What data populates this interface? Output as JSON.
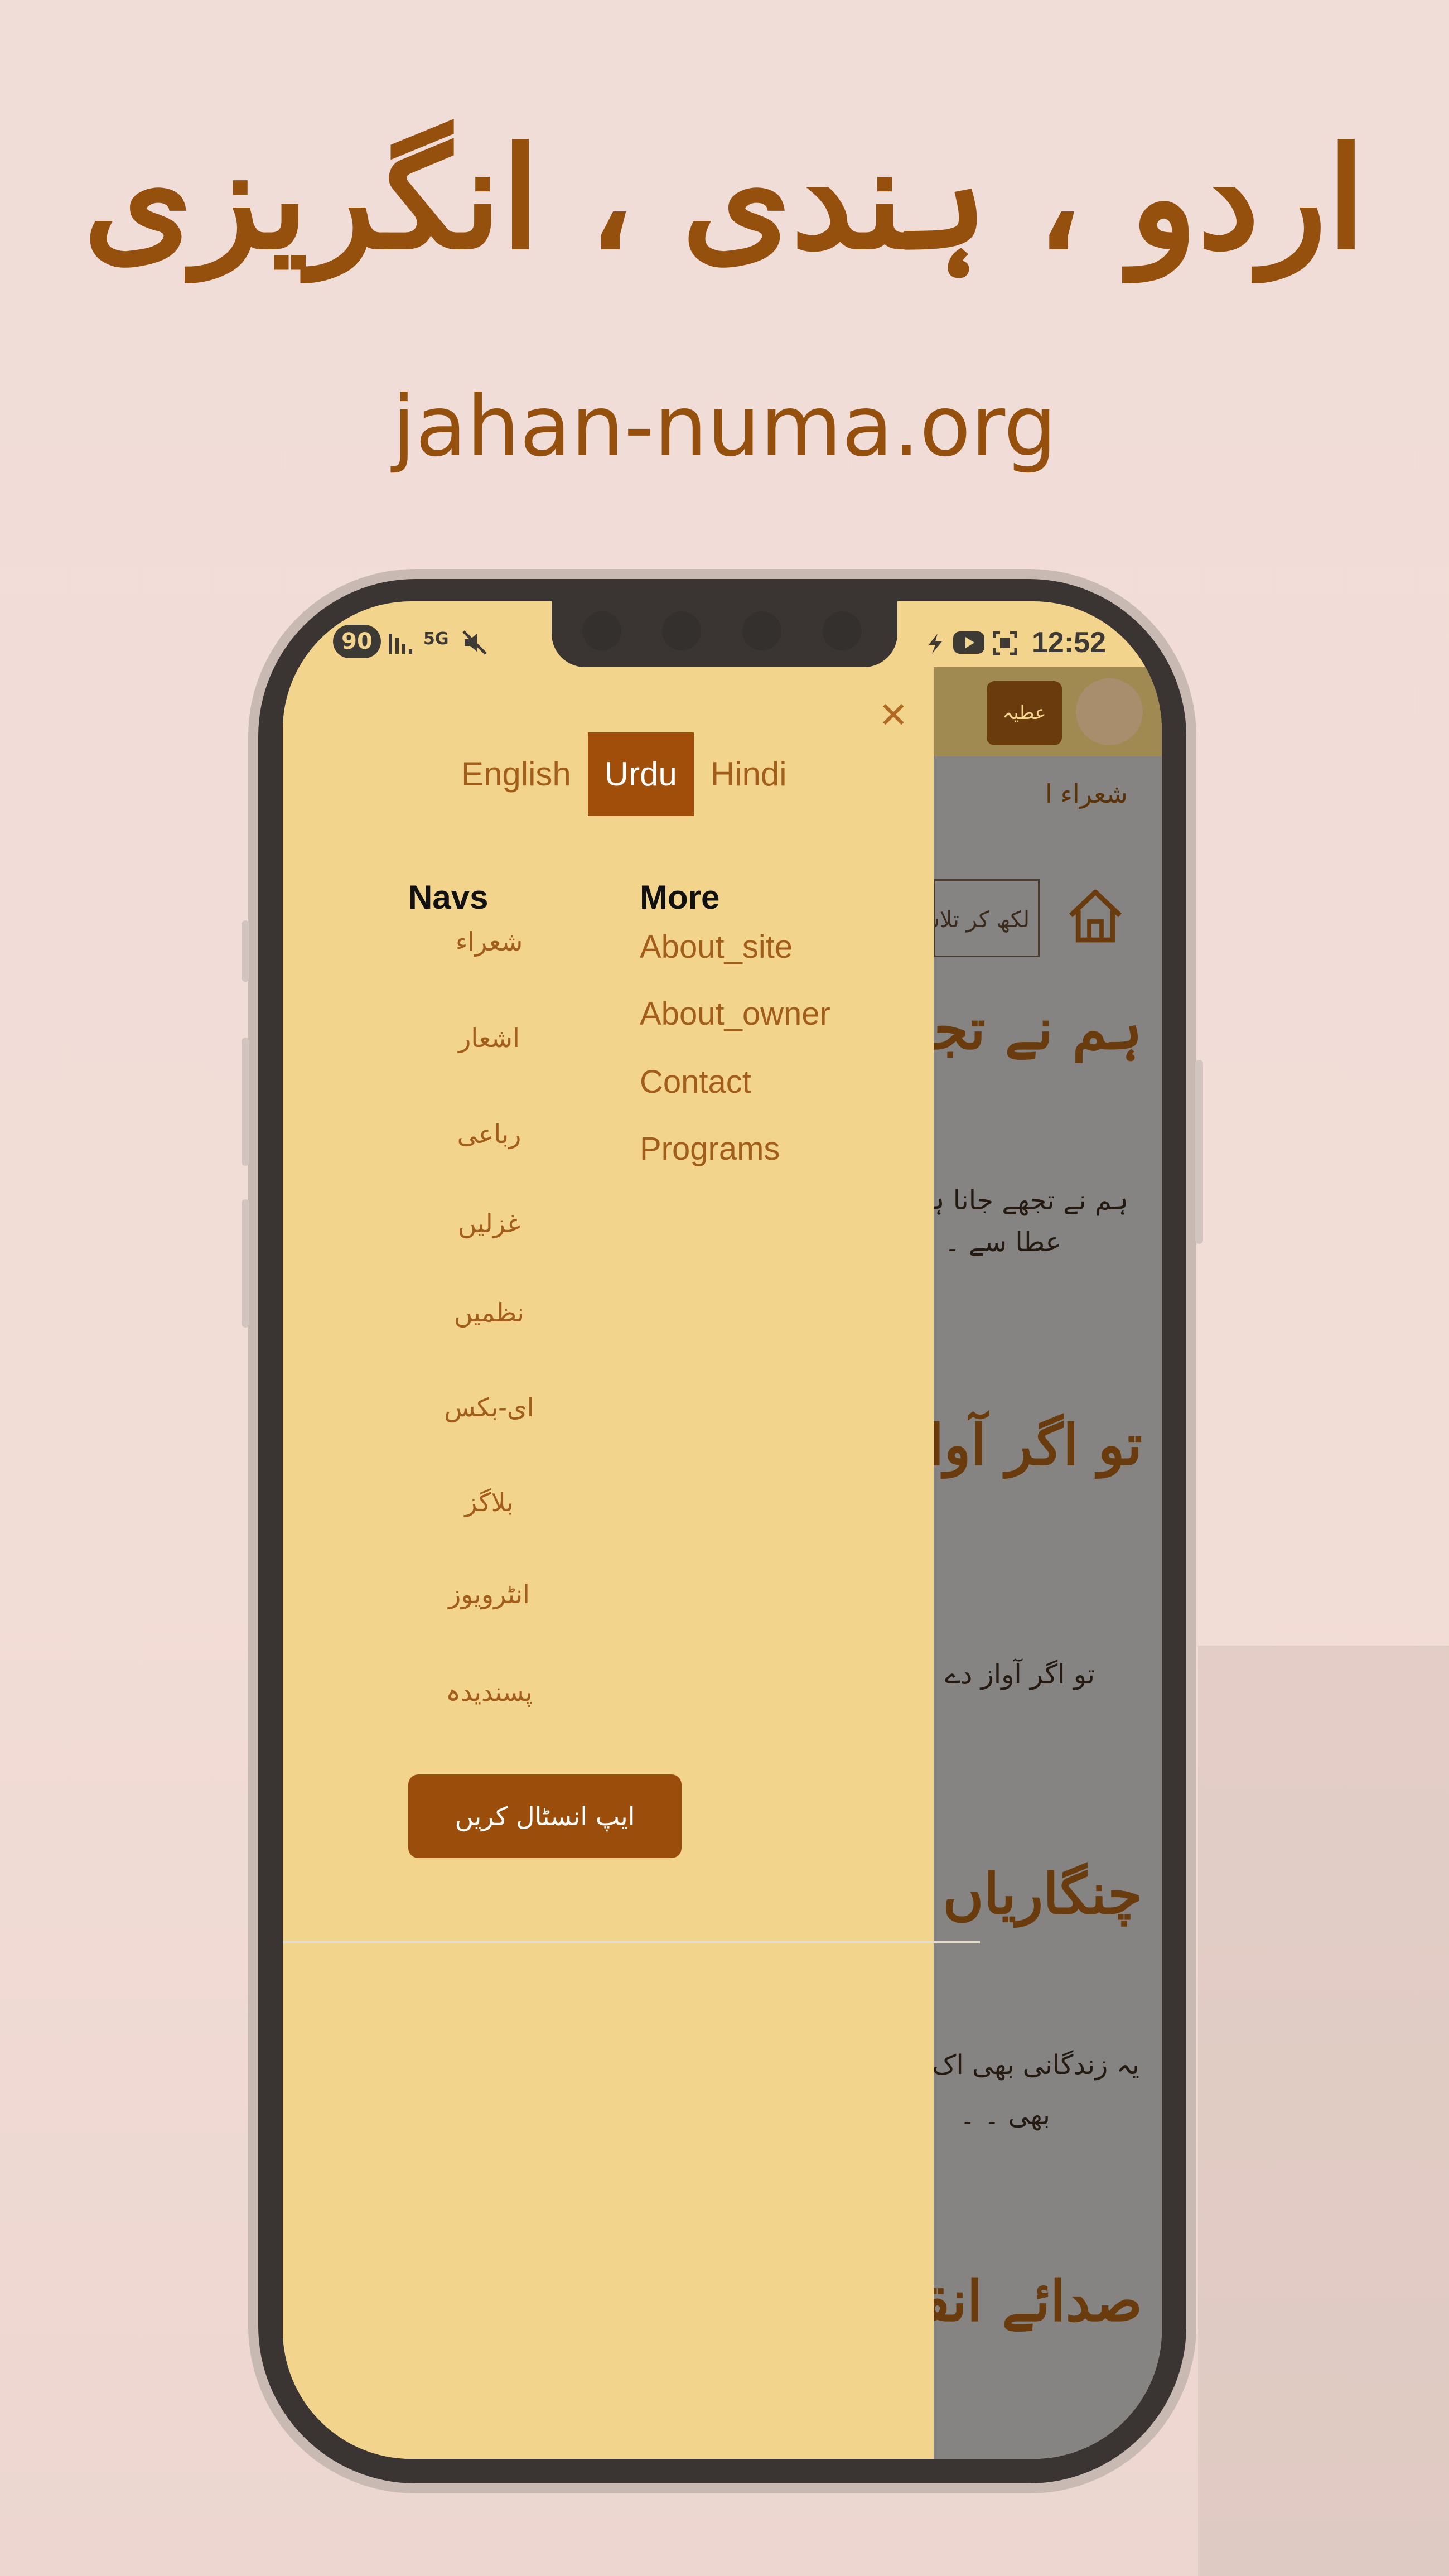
{
  "promo": {
    "title": "اردو ، ہندی ، انگریزی",
    "url": "jahan-numa.org"
  },
  "status_bar": {
    "battery": "90",
    "network": "5G",
    "time": "12:52"
  },
  "page": {
    "header_tile": "عطیہ",
    "tabs": "شعراء        ا",
    "search_placeholder": "لکھ کر تلاش",
    "items": [
      {
        "title": "ہم نے تجھے",
        "text1": "ہم نے تجھے جانا ہے",
        "text2": "عطا سے ۔"
      },
      {
        "title": "تو اگر آواز دے",
        "text1": "تو اگر آواز دے"
      },
      {
        "title": "چنگاریاں",
        "text1": "یہ زندگانی بھی اک جنگ",
        "text2": "بھی ۔ ۔"
      },
      {
        "title": "صدائے انقلاب",
        "text1": ""
      }
    ]
  },
  "drawer": {
    "languages": [
      "English",
      "Urdu",
      "Hindi"
    ],
    "active_language": "Urdu",
    "navs_heading": "Navs",
    "more_heading": "More",
    "navs": [
      "شعراء",
      "اشعار",
      "رباعی",
      "غزلیں",
      "نظمیں",
      "ای-بکس",
      "بلاگز",
      "انٹرویوز",
      "پسندیدہ"
    ],
    "more": [
      "About_site",
      "About_owner",
      "Contact",
      "Programs"
    ],
    "install_button": "ایپ انسٹال کریں"
  },
  "colors": {
    "drawer_bg": "#f3d48c",
    "accent": "#a04e0a",
    "link": "#a25d1a",
    "background": "#f1ddd8"
  }
}
